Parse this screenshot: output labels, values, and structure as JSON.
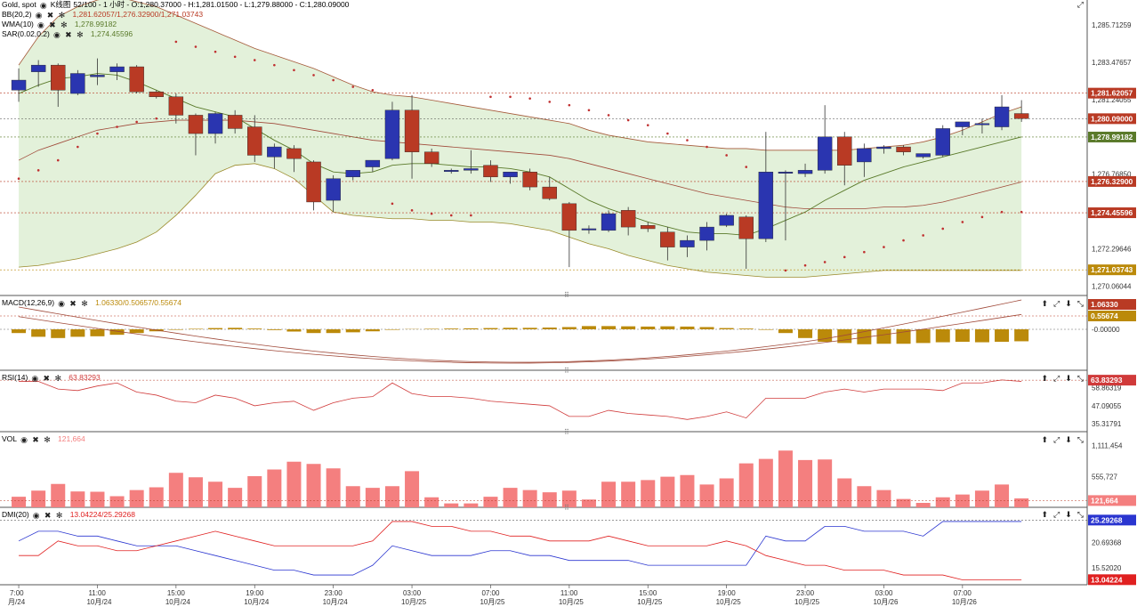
{
  "header": {
    "symbol": "Gold, spot",
    "chart_type": "K线图",
    "ohlc_text": "52/100 - 1 小时 - O:1,280.37000 - H:1,281.01500 - L:1,279.88000 - C:1,280.09000"
  },
  "colors": {
    "up": "#2a35b0",
    "down": "#b93a24",
    "bb_fill": "#e3f1da",
    "ma_line": "#5a7a2a",
    "macd_bar": "#bb8a0a",
    "vol_bar": "#f47f7f",
    "rsi_line": "#d03a3a",
    "dmi_plus": "#2a35d0",
    "dmi_minus": "#e02020",
    "sar_dot": "#c03030"
  },
  "indicators": {
    "bb": {
      "label": "BB(20,2)",
      "values": "1,281.62057/1,276.32900/1,271.03743"
    },
    "wma": {
      "label": "WMA(10)",
      "values": "1,278.99182"
    },
    "sar": {
      "label": "SAR(0.02,0.2)",
      "values": "1,274.45596"
    }
  },
  "panes": {
    "macd": {
      "label": "MACD(12,26,9)",
      "values": "1.06330/0.50657/0.55674"
    },
    "rsi": {
      "label": "RSI(14)",
      "values": "63.83293"
    },
    "vol": {
      "label": "VOL",
      "values": "121,664"
    },
    "dmi": {
      "label": "DMI(20)",
      "values": "13.04224/25.29268"
    }
  },
  "chart_data": {
    "type": "candlestick",
    "candles": [
      {
        "o": 1281.8,
        "h": 1283.1,
        "l": 1281.1,
        "c": 1282.4
      },
      {
        "o": 1282.9,
        "h": 1283.6,
        "l": 1282.0,
        "c": 1283.3
      },
      {
        "o": 1283.3,
        "h": 1283.4,
        "l": 1280.8,
        "c": 1281.8
      },
      {
        "o": 1281.6,
        "h": 1283.0,
        "l": 1281.5,
        "c": 1282.8
      },
      {
        "o": 1282.6,
        "h": 1283.7,
        "l": 1282.1,
        "c": 1282.7
      },
      {
        "o": 1282.9,
        "h": 1283.4,
        "l": 1282.4,
        "c": 1283.2
      },
      {
        "o": 1283.2,
        "h": 1283.3,
        "l": 1281.6,
        "c": 1281.7
      },
      {
        "o": 1281.7,
        "h": 1281.8,
        "l": 1281.3,
        "c": 1281.4
      },
      {
        "o": 1281.4,
        "h": 1281.6,
        "l": 1279.8,
        "c": 1280.3
      },
      {
        "o": 1280.3,
        "h": 1280.4,
        "l": 1277.9,
        "c": 1279.2
      },
      {
        "o": 1279.2,
        "h": 1280.5,
        "l": 1278.6,
        "c": 1280.4
      },
      {
        "o": 1280.3,
        "h": 1280.6,
        "l": 1279.2,
        "c": 1279.5
      },
      {
        "o": 1279.6,
        "h": 1280.3,
        "l": 1277.5,
        "c": 1277.9
      },
      {
        "o": 1277.8,
        "h": 1278.6,
        "l": 1277.1,
        "c": 1278.4
      },
      {
        "o": 1278.3,
        "h": 1278.5,
        "l": 1276.9,
        "c": 1277.7
      },
      {
        "o": 1277.5,
        "h": 1277.6,
        "l": 1274.6,
        "c": 1275.1
      },
      {
        "o": 1275.2,
        "h": 1276.7,
        "l": 1274.5,
        "c": 1276.5
      },
      {
        "o": 1276.6,
        "h": 1277.0,
        "l": 1276.4,
        "c": 1277.0
      },
      {
        "o": 1277.2,
        "h": 1277.3,
        "l": 1276.9,
        "c": 1277.6
      },
      {
        "o": 1277.7,
        "h": 1281.1,
        "l": 1277.6,
        "c": 1280.6
      },
      {
        "o": 1280.6,
        "h": 1281.5,
        "l": 1276.5,
        "c": 1278.1
      },
      {
        "o": 1278.1,
        "h": 1278.3,
        "l": 1277.2,
        "c": 1277.4
      },
      {
        "o": 1277.0,
        "h": 1277.1,
        "l": 1276.8,
        "c": 1277.0
      },
      {
        "o": 1277.0,
        "h": 1278.2,
        "l": 1276.8,
        "c": 1277.1
      },
      {
        "o": 1277.3,
        "h": 1277.6,
        "l": 1276.3,
        "c": 1276.6
      },
      {
        "o": 1276.6,
        "h": 1276.8,
        "l": 1276.2,
        "c": 1276.9
      },
      {
        "o": 1276.9,
        "h": 1277.1,
        "l": 1275.8,
        "c": 1276.0
      },
      {
        "o": 1276.0,
        "h": 1276.6,
        "l": 1275.2,
        "c": 1275.3
      },
      {
        "o": 1275.0,
        "h": 1275.1,
        "l": 1271.2,
        "c": 1273.4
      },
      {
        "o": 1273.5,
        "h": 1273.7,
        "l": 1273.2,
        "c": 1273.5
      },
      {
        "o": 1273.4,
        "h": 1274.6,
        "l": 1273.3,
        "c": 1274.4
      },
      {
        "o": 1274.6,
        "h": 1274.8,
        "l": 1273.1,
        "c": 1273.6
      },
      {
        "o": 1273.7,
        "h": 1273.9,
        "l": 1273.3,
        "c": 1273.5
      },
      {
        "o": 1273.3,
        "h": 1273.6,
        "l": 1271.6,
        "c": 1272.4
      },
      {
        "o": 1272.4,
        "h": 1273.1,
        "l": 1271.8,
        "c": 1272.8
      },
      {
        "o": 1272.8,
        "h": 1273.9,
        "l": 1272.2,
        "c": 1273.6
      },
      {
        "o": 1273.7,
        "h": 1274.4,
        "l": 1273.6,
        "c": 1274.3
      },
      {
        "o": 1274.2,
        "h": 1274.3,
        "l": 1271.1,
        "c": 1272.9
      },
      {
        "o": 1272.9,
        "h": 1279.3,
        "l": 1272.7,
        "c": 1276.9
      },
      {
        "o": 1276.9,
        "h": 1277.0,
        "l": 1272.8,
        "c": 1276.9
      },
      {
        "o": 1276.8,
        "h": 1277.4,
        "l": 1276.6,
        "c": 1277.0
      },
      {
        "o": 1277.0,
        "h": 1280.9,
        "l": 1276.8,
        "c": 1279.0
      },
      {
        "o": 1279.0,
        "h": 1279.3,
        "l": 1276.1,
        "c": 1277.3
      },
      {
        "o": 1277.5,
        "h": 1278.6,
        "l": 1276.6,
        "c": 1278.3
      },
      {
        "o": 1278.3,
        "h": 1278.5,
        "l": 1278.0,
        "c": 1278.4
      },
      {
        "o": 1278.4,
        "h": 1278.5,
        "l": 1277.9,
        "c": 1278.1
      },
      {
        "o": 1277.8,
        "h": 1278.0,
        "l": 1277.7,
        "c": 1278.0
      },
      {
        "o": 1277.9,
        "h": 1279.7,
        "l": 1277.8,
        "c": 1279.5
      },
      {
        "o": 1279.6,
        "h": 1279.9,
        "l": 1279.1,
        "c": 1279.9
      },
      {
        "o": 1279.8,
        "h": 1280.1,
        "l": 1279.2,
        "c": 1279.8
      },
      {
        "o": 1279.6,
        "h": 1281.5,
        "l": 1279.4,
        "c": 1280.8
      },
      {
        "o": 1280.4,
        "h": 1281.2,
        "l": 1279.9,
        "c": 1280.1
      }
    ],
    "bb_upper": [
      1283.3,
      1285.0,
      1286.2,
      1286.8,
      1287.2,
      1287.4,
      1287.1,
      1286.8,
      1286.3,
      1285.8,
      1285.3,
      1284.8,
      1284.3,
      1283.9,
      1283.5,
      1283.1,
      1282.6,
      1282.1,
      1281.7,
      1281.5,
      1281.4,
      1281.2,
      1281.0,
      1280.8,
      1280.6,
      1280.4,
      1280.2,
      1280.0,
      1279.8,
      1279.4,
      1279.1,
      1278.9,
      1278.7,
      1278.6,
      1278.5,
      1278.4,
      1278.3,
      1278.3,
      1278.2,
      1278.2,
      1278.2,
      1278.2,
      1278.2,
      1278.3,
      1278.4,
      1278.5,
      1278.7,
      1279.0,
      1279.4,
      1279.9,
      1280.4,
      1280.8
    ],
    "bb_mid": [
      1277.6,
      1278.2,
      1278.6,
      1279.0,
      1279.4,
      1279.6,
      1279.8,
      1279.9,
      1280.0,
      1280.0,
      1280.0,
      1280.0,
      1279.9,
      1279.8,
      1279.6,
      1279.4,
      1279.2,
      1279.0,
      1278.8,
      1278.7,
      1278.6,
      1278.5,
      1278.4,
      1278.3,
      1278.2,
      1278.1,
      1278.0,
      1277.9,
      1277.7,
      1277.4,
      1277.1,
      1276.8,
      1276.5,
      1276.2,
      1275.9,
      1275.6,
      1275.4,
      1275.2,
      1275.0,
      1274.8,
      1274.7,
      1274.7,
      1274.7,
      1274.7,
      1274.8,
      1274.8,
      1274.9,
      1275.1,
      1275.4,
      1275.7,
      1276.0,
      1276.3
    ],
    "bb_lower": [
      1271.2,
      1271.3,
      1271.5,
      1271.7,
      1272.0,
      1272.3,
      1272.7,
      1273.3,
      1274.3,
      1275.5,
      1276.8,
      1277.3,
      1277.4,
      1277.1,
      1276.5,
      1275.5,
      1274.5,
      1274.3,
      1274.2,
      1274.1,
      1274.1,
      1274.0,
      1274.0,
      1273.9,
      1273.9,
      1273.8,
      1273.6,
      1273.4,
      1273.0,
      1272.6,
      1272.3,
      1271.9,
      1271.6,
      1271.3,
      1271.1,
      1270.9,
      1270.8,
      1270.7,
      1270.6,
      1270.6,
      1270.6,
      1270.7,
      1270.8,
      1270.9,
      1271.0,
      1271.0,
      1271.0,
      1271.0,
      1271.0,
      1271.0,
      1271.0,
      1271.0
    ],
    "wma": [
      1281.6,
      1282.1,
      1282.5,
      1282.6,
      1282.8,
      1282.7,
      1282.3,
      1281.8,
      1281.3,
      1280.8,
      1280.5,
      1280.2,
      1279.5,
      1278.8,
      1278.2,
      1277.4,
      1276.9,
      1276.8,
      1276.9,
      1277.3,
      1277.4,
      1277.4,
      1277.3,
      1277.2,
      1277.2,
      1277.1,
      1276.9,
      1276.6,
      1275.9,
      1275.2,
      1274.7,
      1274.3,
      1273.9,
      1273.6,
      1273.3,
      1273.2,
      1273.2,
      1273.1,
      1273.5,
      1274.0,
      1274.5,
      1275.2,
      1275.8,
      1276.4,
      1276.8,
      1277.2,
      1277.5,
      1277.8,
      1278.1,
      1278.4,
      1278.7,
      1279.0
    ],
    "sar": [
      1276.5,
      1277.0,
      1277.6,
      1278.4,
      1279.2,
      1279.6,
      1279.9,
      1280.1,
      1284.7,
      1284.4,
      1284.1,
      1283.8,
      1283.6,
      1283.3,
      1283.0,
      1282.7,
      1282.4,
      1282.0,
      1281.8,
      1275.0,
      1274.6,
      1274.4,
      1274.3,
      1274.3,
      1281.4,
      1281.4,
      1281.3,
      1281.1,
      1280.9,
      1280.6,
      1280.3,
      1280.0,
      1279.7,
      1279.2,
      1278.8,
      1278.4,
      1277.9,
      1277.2,
      1276.2,
      1271.0,
      1271.3,
      1271.5,
      1271.8,
      1272.1,
      1272.4,
      1272.8,
      1273.1,
      1273.5,
      1273.9,
      1274.2,
      1274.5,
      1274.5
    ],
    "macd_hist": [
      -0.15,
      -0.3,
      -0.35,
      -0.3,
      -0.28,
      -0.22,
      -0.15,
      -0.08,
      -0.02,
      0.02,
      0.05,
      0.06,
      0.03,
      -0.03,
      -0.09,
      -0.15,
      -0.15,
      -0.12,
      -0.08,
      -0.02,
      0.01,
      0.02,
      0.03,
      0.04,
      0.05,
      0.06,
      0.06,
      0.07,
      0.09,
      0.13,
      0.13,
      0.12,
      0.11,
      0.12,
      0.11,
      0.09,
      0.05,
      0.03,
      -0.02,
      -0.15,
      -0.35,
      -0.5,
      -0.55,
      -0.6,
      -0.58,
      -0.58,
      -0.55,
      -0.52,
      -0.5,
      -0.52,
      -0.5,
      -0.48
    ],
    "macd_hist_sign_inverted_for_display": false,
    "rsi": [
      63,
      63,
      58,
      57,
      60,
      62,
      56,
      54,
      50,
      49,
      54,
      52,
      47,
      49,
      50,
      44,
      49,
      52,
      53,
      62,
      55,
      53,
      53,
      52,
      50,
      49,
      48,
      47,
      40,
      40,
      44,
      42,
      41,
      40,
      38,
      40,
      43,
      39,
      52,
      52,
      52,
      56,
      58,
      56,
      58,
      58,
      58,
      57,
      62,
      62,
      64,
      63
    ],
    "volume": [
      190000,
      300000,
      420000,
      285000,
      280000,
      200000,
      310000,
      360000,
      620000,
      540000,
      460000,
      350000,
      560000,
      680000,
      820000,
      780000,
      700000,
      380000,
      350000,
      380000,
      650000,
      180000,
      70000,
      70000,
      190000,
      350000,
      310000,
      270000,
      300000,
      140000,
      460000,
      460000,
      490000,
      550000,
      580000,
      410000,
      520000,
      790000,
      870000,
      1020000,
      850000,
      860000,
      520000,
      380000,
      310000,
      150000,
      80000,
      180000,
      230000,
      300000,
      410000,
      160000
    ],
    "dmi_plus": [
      21,
      23,
      23,
      22,
      22,
      21,
      20,
      20,
      20,
      19,
      18,
      17,
      16,
      15,
      15,
      14,
      14,
      14,
      16,
      20,
      19,
      18,
      18,
      18,
      19,
      19,
      18,
      18,
      17,
      17,
      17,
      17,
      16,
      16,
      16,
      16,
      16,
      16,
      22,
      21,
      21,
      24,
      24,
      23,
      23,
      23,
      22,
      25,
      25,
      25,
      25,
      25
    ],
    "dmi_minus": [
      18,
      18,
      21,
      20,
      20,
      19,
      19,
      20,
      21,
      22,
      23,
      22,
      21,
      20,
      20,
      20,
      20,
      20,
      21,
      25,
      25,
      24,
      24,
      23,
      23,
      22,
      22,
      21,
      21,
      21,
      22,
      21,
      20,
      20,
      20,
      20,
      21,
      20,
      18,
      17,
      16,
      16,
      15,
      15,
      15,
      14,
      14,
      14,
      13,
      13,
      13,
      13
    ],
    "price_axis": {
      "main": [
        "1,285.71259",
        "1,283.47657",
        "1,281.24055",
        "1,276.76850",
        "1,272.29646",
        "1,270.06044"
      ],
      "macd": [
        "-0.00000"
      ],
      "rsi": [
        "58.86319",
        "47.09055",
        "35.31791"
      ],
      "vol": [
        "1,111,454",
        "555,727"
      ],
      "dmi": [
        "20.69368",
        "15.52020"
      ]
    },
    "price_flags": {
      "bb_upper": "1,281.62057",
      "close": "1,280.09000",
      "wma": "1,278.99182",
      "bb_mid": "1,276.32900",
      "sar": "1,274.45596",
      "bb_lower": "1,271.03743",
      "macd1": "1.06330",
      "macd2": "0.55674",
      "rsi": "63.83293",
      "vol": "121,664",
      "dmi_plus": "25.29268",
      "dmi_minus": "13.04224"
    },
    "time_axis": [
      {
        "time": "7:00",
        "date": "月/24",
        "idx": 0
      },
      {
        "time": "11:00",
        "date": "10月/24",
        "idx": 4
      },
      {
        "time": "15:00",
        "date": "10月/24",
        "idx": 8
      },
      {
        "time": "19:00",
        "date": "10月/24",
        "idx": 12
      },
      {
        "time": "23:00",
        "date": "10月/24",
        "idx": 16
      },
      {
        "time": "03:00",
        "date": "10月/25",
        "idx": 20
      },
      {
        "time": "07:00",
        "date": "10月/25",
        "idx": 24
      },
      {
        "time": "11:00",
        "date": "10月/25",
        "idx": 28
      },
      {
        "time": "15:00",
        "date": "10月/25",
        "idx": 32
      },
      {
        "time": "19:00",
        "date": "10月/25",
        "idx": 36
      },
      {
        "time": "23:00",
        "date": "10月/25",
        "idx": 40
      },
      {
        "time": "03:00",
        "date": "10月/26",
        "idx": 44
      },
      {
        "time": "07:00",
        "date": "10月/26",
        "idx": 48
      }
    ]
  }
}
